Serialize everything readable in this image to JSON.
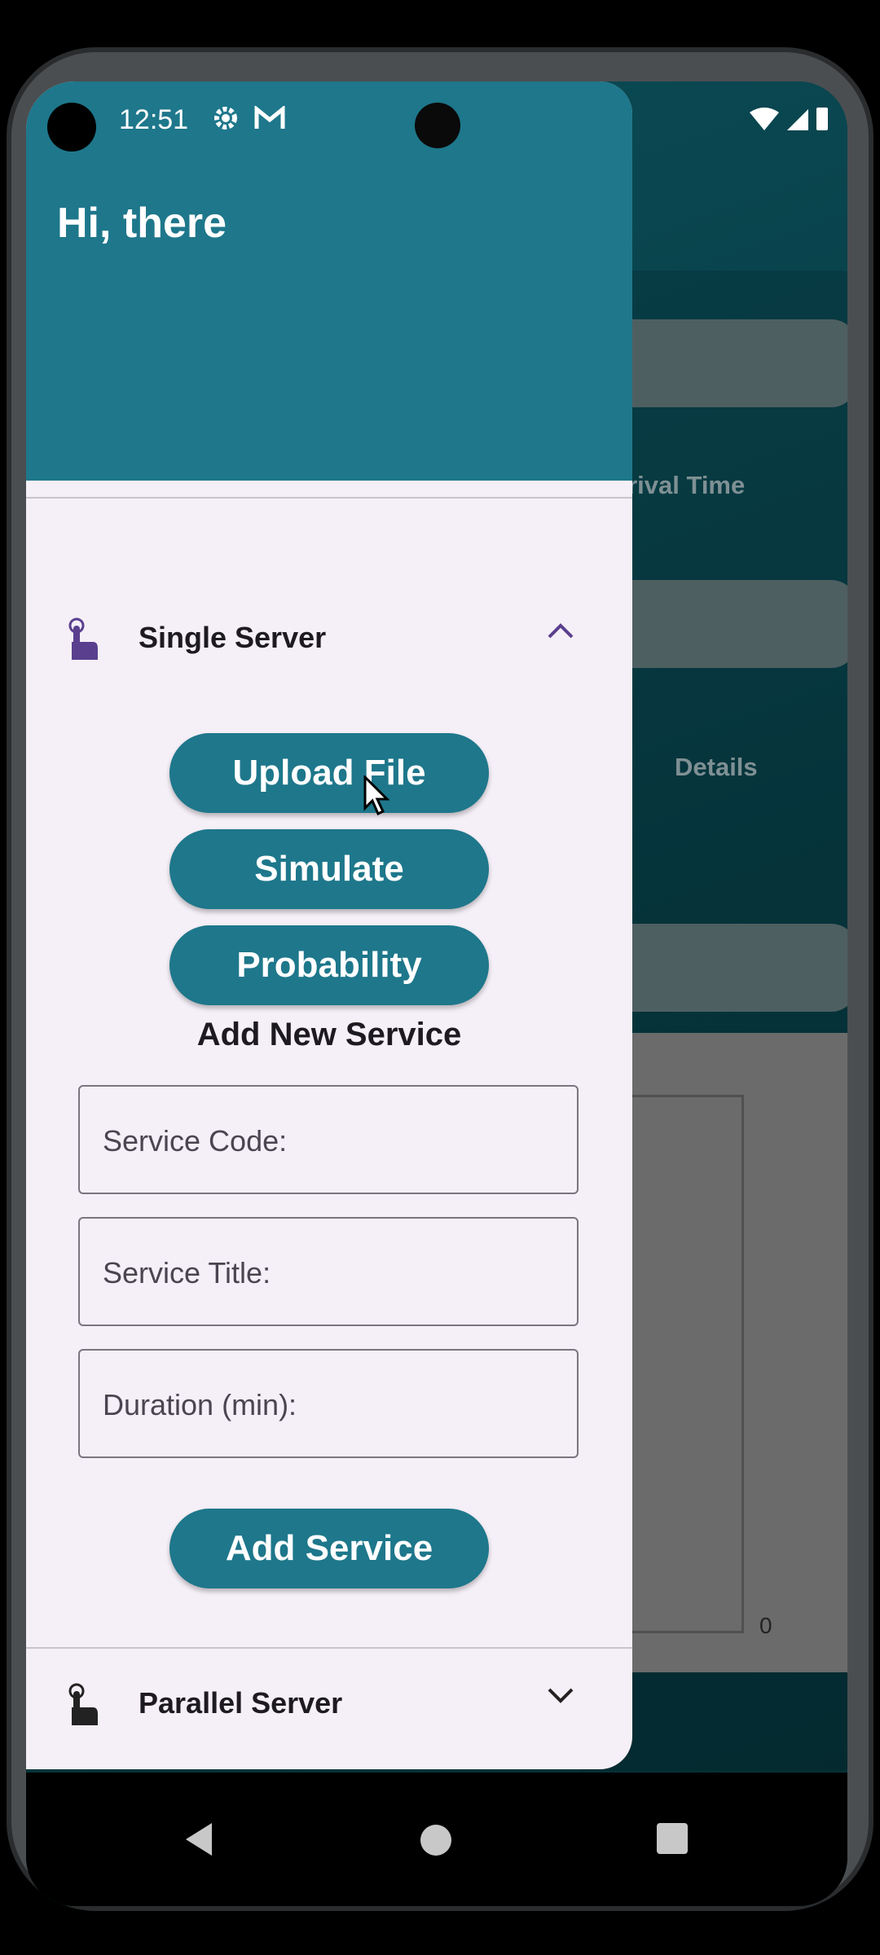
{
  "status_bar": {
    "time": "12:51"
  },
  "drawer": {
    "greeting": "Hi, there",
    "single_server": {
      "label": "Single Server",
      "buttons": [
        "Upload File",
        "Simulate",
        "Probability"
      ],
      "add_title": "Add New Service",
      "fields": [
        "Service Code:",
        "Service Title:",
        "Duration (min):"
      ],
      "add_button": "Add Service"
    },
    "parallel_server": {
      "label": "Parallel Server"
    }
  },
  "background": {
    "arrival_label": "rrival Time",
    "details_label": "Details",
    "chart_zero": "0"
  },
  "colors": {
    "primary": "#1e778b",
    "drawer_bg": "#f5eff7",
    "accent": "#5a3f8e"
  }
}
